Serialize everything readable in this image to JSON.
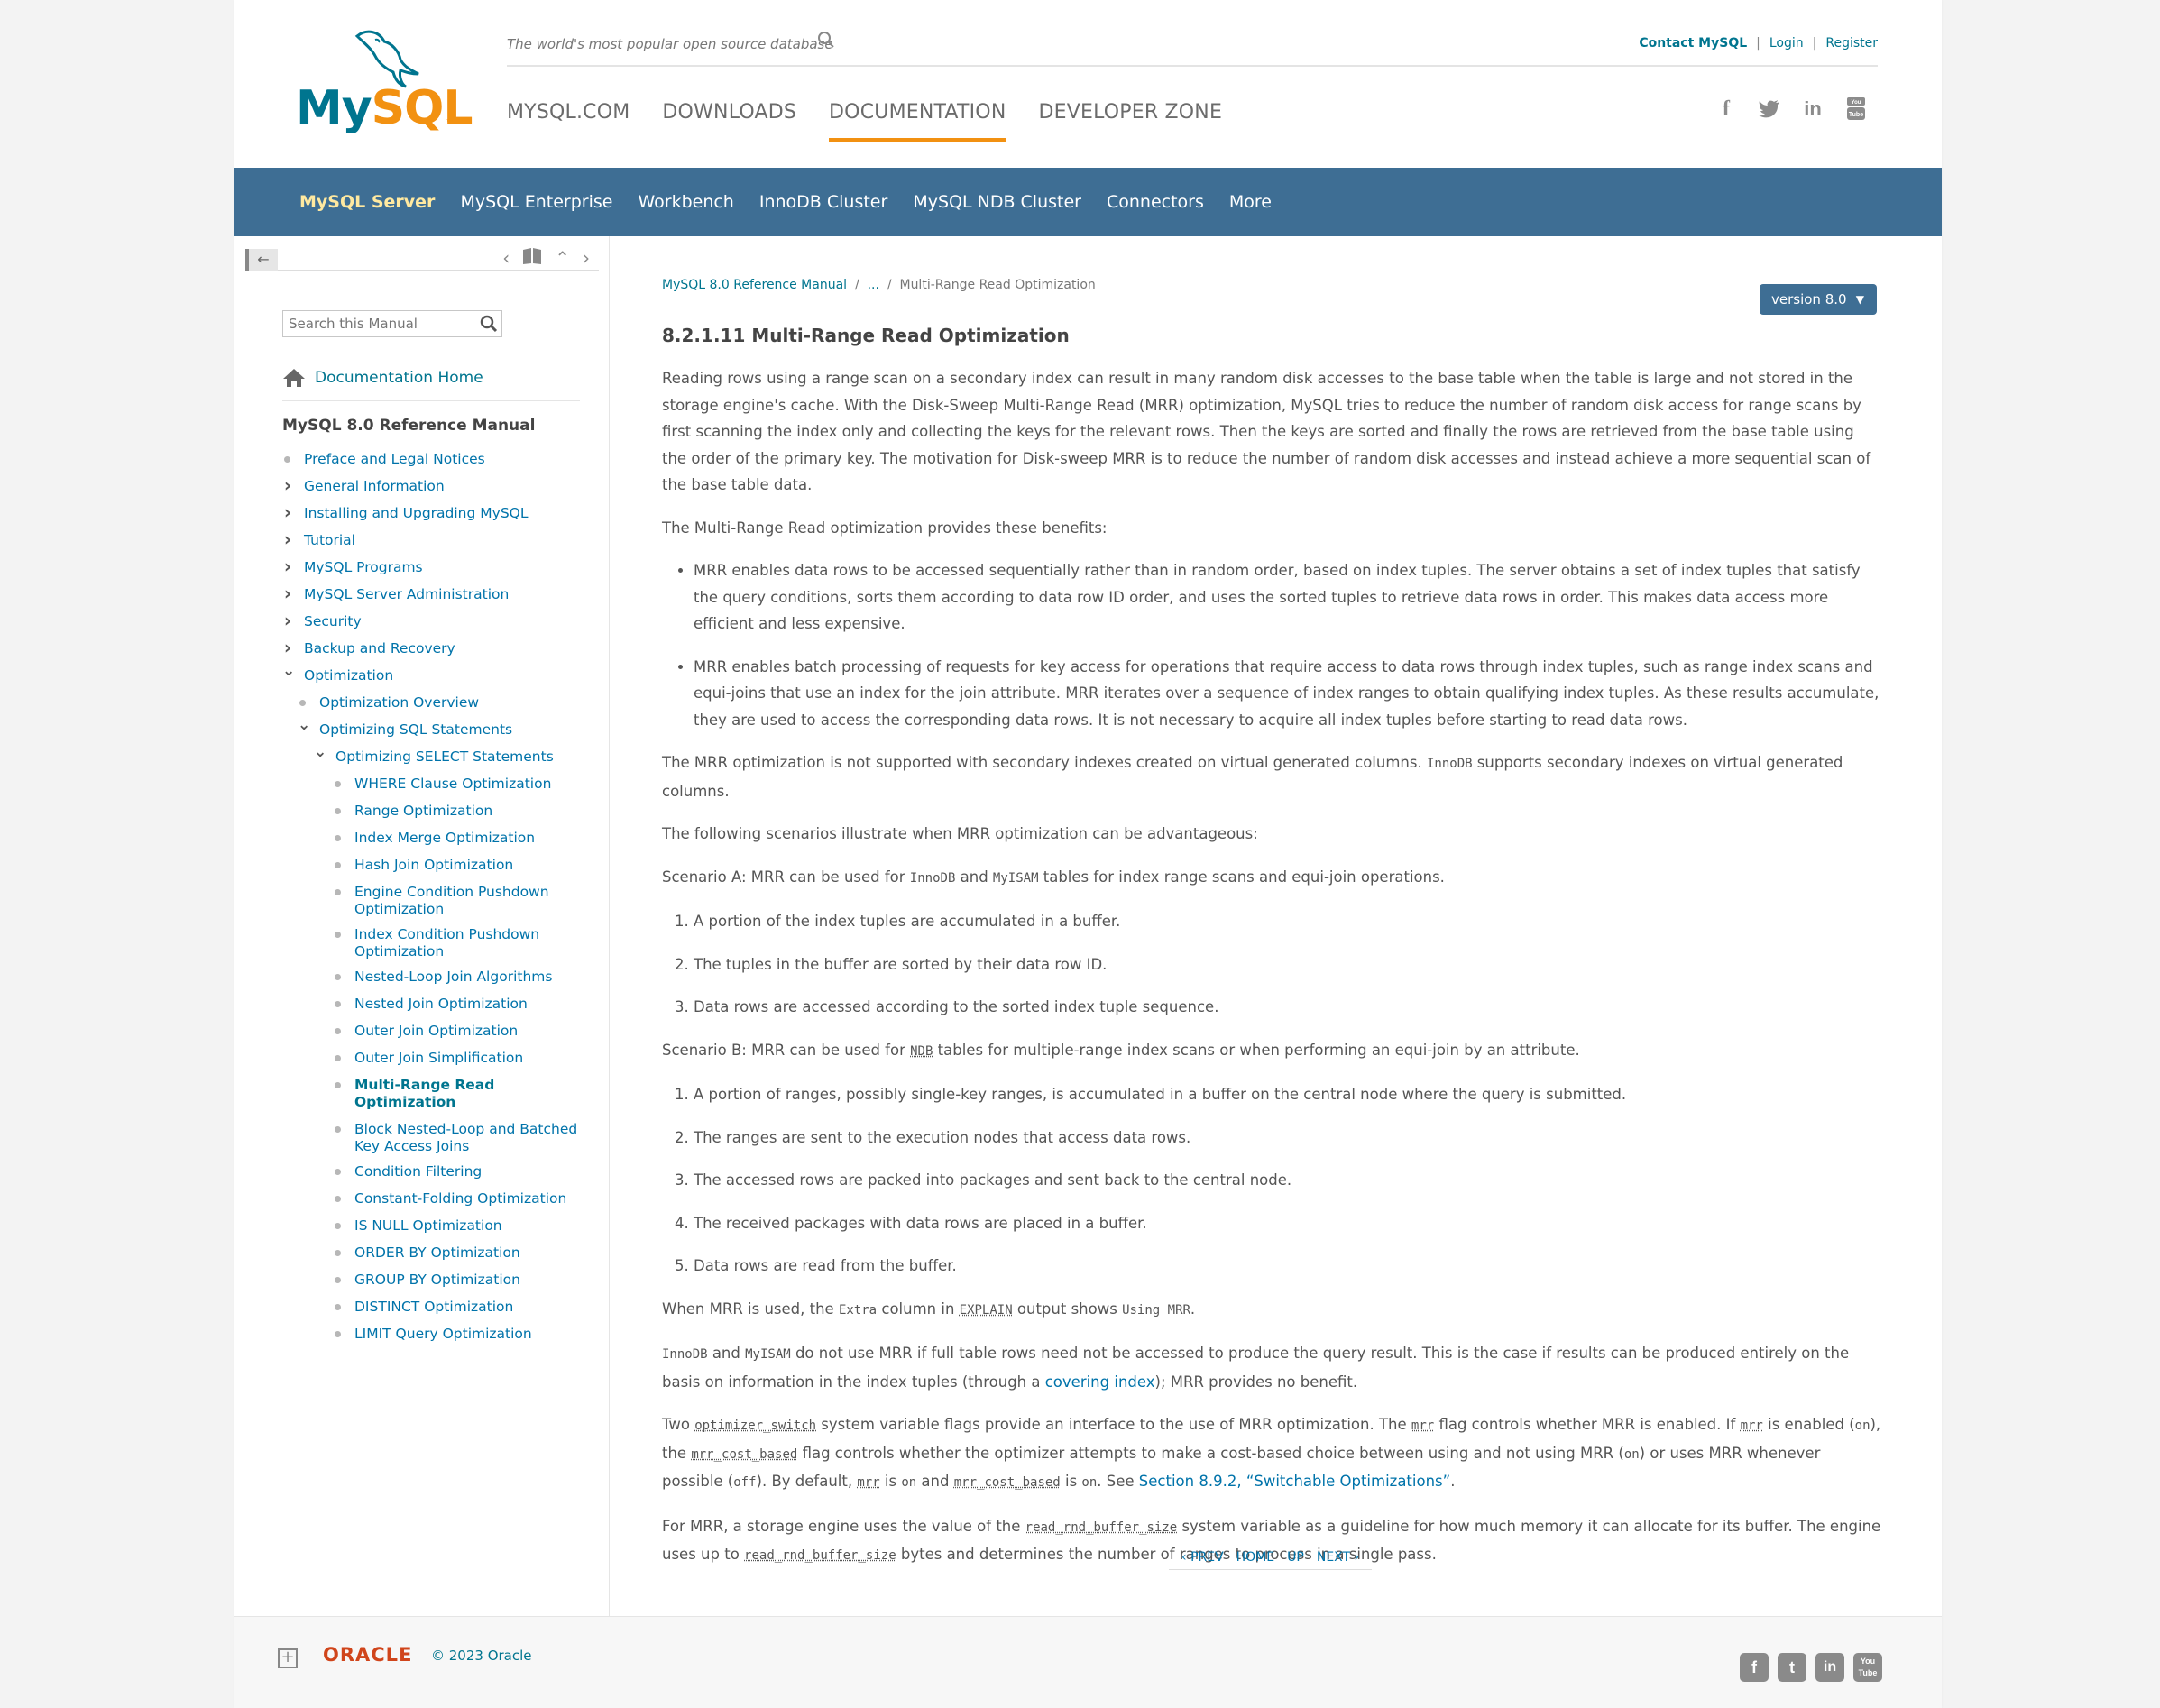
{
  "header": {
    "logo_my": "My",
    "logo_sql": "SQL",
    "logo_tm": "™",
    "tagline": "The world's most popular open source database",
    "top_links": {
      "contact": "Contact MySQL",
      "login": "Login",
      "register": "Register",
      "sep": "|"
    },
    "main_nav": [
      "MYSQL.COM",
      "DOWNLOADS",
      "DOCUMENTATION",
      "DEVELOPER ZONE"
    ],
    "social_icons": [
      "facebook-icon",
      "twitter-icon",
      "linkedin-icon",
      "youtube-icon"
    ]
  },
  "product_bar": [
    "MySQL Server",
    "MySQL Enterprise",
    "Workbench",
    "InnoDB Cluster",
    "MySQL NDB Cluster",
    "Connectors",
    "More"
  ],
  "sidebar": {
    "search_placeholder": "Search this Manual",
    "doc_home": "Documentation Home",
    "manual_title": "MySQL 8.0 Reference Manual",
    "toc": [
      {
        "label": "Preface and Legal Notices",
        "kind": "dot",
        "level": 0
      },
      {
        "label": "General Information",
        "kind": "closed",
        "level": 0
      },
      {
        "label": "Installing and Upgrading MySQL",
        "kind": "closed",
        "level": 0
      },
      {
        "label": "Tutorial",
        "kind": "closed",
        "level": 0
      },
      {
        "label": "MySQL Programs",
        "kind": "closed",
        "level": 0
      },
      {
        "label": "MySQL Server Administration",
        "kind": "closed",
        "level": 0
      },
      {
        "label": "Security",
        "kind": "closed",
        "level": 0
      },
      {
        "label": "Backup and Recovery",
        "kind": "closed",
        "level": 0
      },
      {
        "label": "Optimization",
        "kind": "open",
        "level": 0
      },
      {
        "label": "Optimization Overview",
        "kind": "dot",
        "level": 1
      },
      {
        "label": "Optimizing SQL Statements",
        "kind": "open",
        "level": 1
      },
      {
        "label": "Optimizing SELECT Statements",
        "kind": "open",
        "level": 2
      },
      {
        "label": "WHERE Clause Optimization",
        "kind": "dot",
        "level": 3
      },
      {
        "label": "Range Optimization",
        "kind": "dot",
        "level": 3
      },
      {
        "label": "Index Merge Optimization",
        "kind": "dot",
        "level": 3
      },
      {
        "label": "Hash Join Optimization",
        "kind": "dot",
        "level": 3
      },
      {
        "label": "Engine Condition Pushdown Optimization",
        "kind": "dot",
        "level": 3
      },
      {
        "label": "Index Condition Pushdown Optimization",
        "kind": "dot",
        "level": 3
      },
      {
        "label": "Nested-Loop Join Algorithms",
        "kind": "dot",
        "level": 3
      },
      {
        "label": "Nested Join Optimization",
        "kind": "dot",
        "level": 3
      },
      {
        "label": "Outer Join Optimization",
        "kind": "dot",
        "level": 3
      },
      {
        "label": "Outer Join Simplification",
        "kind": "dot",
        "level": 3
      },
      {
        "label": "Multi-Range Read Optimization",
        "kind": "dot",
        "level": 3,
        "current": true
      },
      {
        "label": "Block Nested-Loop and Batched Key Access Joins",
        "kind": "dot",
        "level": 3
      },
      {
        "label": "Condition Filtering",
        "kind": "dot",
        "level": 3
      },
      {
        "label": "Constant-Folding Optimization",
        "kind": "dot",
        "level": 3
      },
      {
        "label": "IS NULL Optimization",
        "kind": "dot",
        "level": 3
      },
      {
        "label": "ORDER BY Optimization",
        "kind": "dot",
        "level": 3
      },
      {
        "label": "GROUP BY Optimization",
        "kind": "dot",
        "level": 3
      },
      {
        "label": "DISTINCT Optimization",
        "kind": "dot",
        "level": 3
      },
      {
        "label": "LIMIT Query Optimization",
        "kind": "dot",
        "level": 3
      }
    ]
  },
  "breadcrumb": {
    "root": "MySQL 8.0 Reference Manual",
    "sep": "/",
    "ellipsis": "...",
    "current": "Multi-Range Read Optimization"
  },
  "version_button": "version 8.0",
  "article": {
    "title": "8.2.1.11 Multi-Range Read Optimization",
    "p1": "Reading rows using a range scan on a secondary index can result in many random disk accesses to the base table when the table is large and not stored in the storage engine's cache. With the Disk-Sweep Multi-Range Read (MRR) optimization, MySQL tries to reduce the number of random disk access for range scans by first scanning the index only and collecting the keys for the relevant rows. Then the keys are sorted and finally the rows are retrieved from the base table using the order of the primary key. The motivation for Disk-sweep MRR is to reduce the number of random disk accesses and instead achieve a more sequential scan of the base table data.",
    "p2": "The Multi-Range Read optimization provides these benefits:",
    "bullet1": "MRR enables data rows to be accessed sequentially rather than in random order, based on index tuples. The server obtains a set of index tuples that satisfy the query conditions, sorts them according to data row ID order, and uses the sorted tuples to retrieve data rows in order. This makes data access more efficient and less expensive.",
    "bullet2": "MRR enables batch processing of requests for key access for operations that require access to data rows through index tuples, such as range index scans and equi-joins that use an index for the join attribute. MRR iterates over a sequence of index ranges to obtain qualifying index tuples. As these results accumulate, they are used to access the corresponding data rows. It is not necessary to acquire all index tuples before starting to read data rows.",
    "p3a": "The MRR optimization is not supported with secondary indexes created on virtual generated columns. ",
    "p3code": "InnoDB",
    "p3b": " supports secondary indexes on virtual generated columns.",
    "p4": "The following scenarios illustrate when MRR optimization can be advantageous:",
    "scenA_a": "Scenario A: MRR can be used for ",
    "scenA_c1": "InnoDB",
    "scenA_b": " and ",
    "scenA_c2": "MyISAM",
    "scenA_c": " tables for index range scans and equi-join operations.",
    "listA": [
      "A portion of the index tuples are accumulated in a buffer.",
      "The tuples in the buffer are sorted by their data row ID.",
      "Data rows are accessed according to the sorted index tuple sequence."
    ],
    "scenB_a": "Scenario B: MRR can be used for ",
    "scenB_c1": "NDB",
    "scenB_b": " tables for multiple-range index scans or when performing an equi-join by an attribute.",
    "listB": [
      "A portion of ranges, possibly single-key ranges, is accumulated in a buffer on the central node where the query is submitted.",
      "The ranges are sent to the execution nodes that access data rows.",
      "The accessed rows are packed into packages and sent back to the central node.",
      "The received packages with data rows are placed in a buffer.",
      "Data rows are read from the buffer."
    ],
    "p5a": "When MRR is used, the ",
    "p5c1": "Extra",
    "p5b": " column in ",
    "p5c2": "EXPLAIN",
    "p5c": " output shows ",
    "p5c3": "Using MRR",
    "p5d": ".",
    "p6c1": "InnoDB",
    "p6a": " and ",
    "p6c2": "MyISAM",
    "p6b": " do not use MRR if full table rows need not be accessed to produce the query result. This is the case if results can be produced entirely on the basis on information in the index tuples (through a ",
    "p6link": "covering index",
    "p6c": "); MRR provides no benefit.",
    "p7a": "Two ",
    "p7c1": "optimizer_switch",
    "p7b": " system variable flags provide an interface to the use of MRR optimization. The ",
    "p7c2": "mrr",
    "p7c": " flag controls whether MRR is enabled. If ",
    "p7c3": "mrr",
    "p7d": " is enabled (",
    "p7c4": "on",
    "p7e": "), the ",
    "p7c5": "mrr_cost_based",
    "p7f": " flag controls whether the optimizer attempts to make a cost-based choice between using and not using MRR (",
    "p7c6": "on",
    "p7g": ") or uses MRR whenever possible (",
    "p7c7": "off",
    "p7h": "). By default, ",
    "p7c8": "mrr",
    "p7i": " is ",
    "p7c9": "on",
    "p7j": " and ",
    "p7c10": "mrr_cost_based",
    "p7k": " is ",
    "p7c11": "on",
    "p7l": ". See ",
    "p7link": "Section 8.9.2, “Switchable Optimizations”",
    "p7m": ".",
    "p8a": "For MRR, a storage engine uses the value of the ",
    "p8c1": "read_rnd_buffer_size",
    "p8b": " system variable as a guideline for how much memory it can allocate for its buffer. The engine uses up to ",
    "p8c2": "read_rnd_buffer_size",
    "p8c": " bytes and determines the number of ranges to process in a single pass."
  },
  "pager": {
    "prev": "PREV",
    "home": "HOME",
    "up": "UP",
    "next": "NEXT"
  },
  "footer": {
    "oracle": "ORACLE",
    "copyright": "© 2023 Oracle",
    "social_icons": [
      "facebook-icon",
      "twitter-icon",
      "linkedin-icon",
      "youtube-icon"
    ]
  },
  "colors": {
    "brand_blue": "#00758f",
    "brand_orange": "#f29111",
    "product_bar": "#3e6e94",
    "oracle_red": "#d0451b"
  }
}
